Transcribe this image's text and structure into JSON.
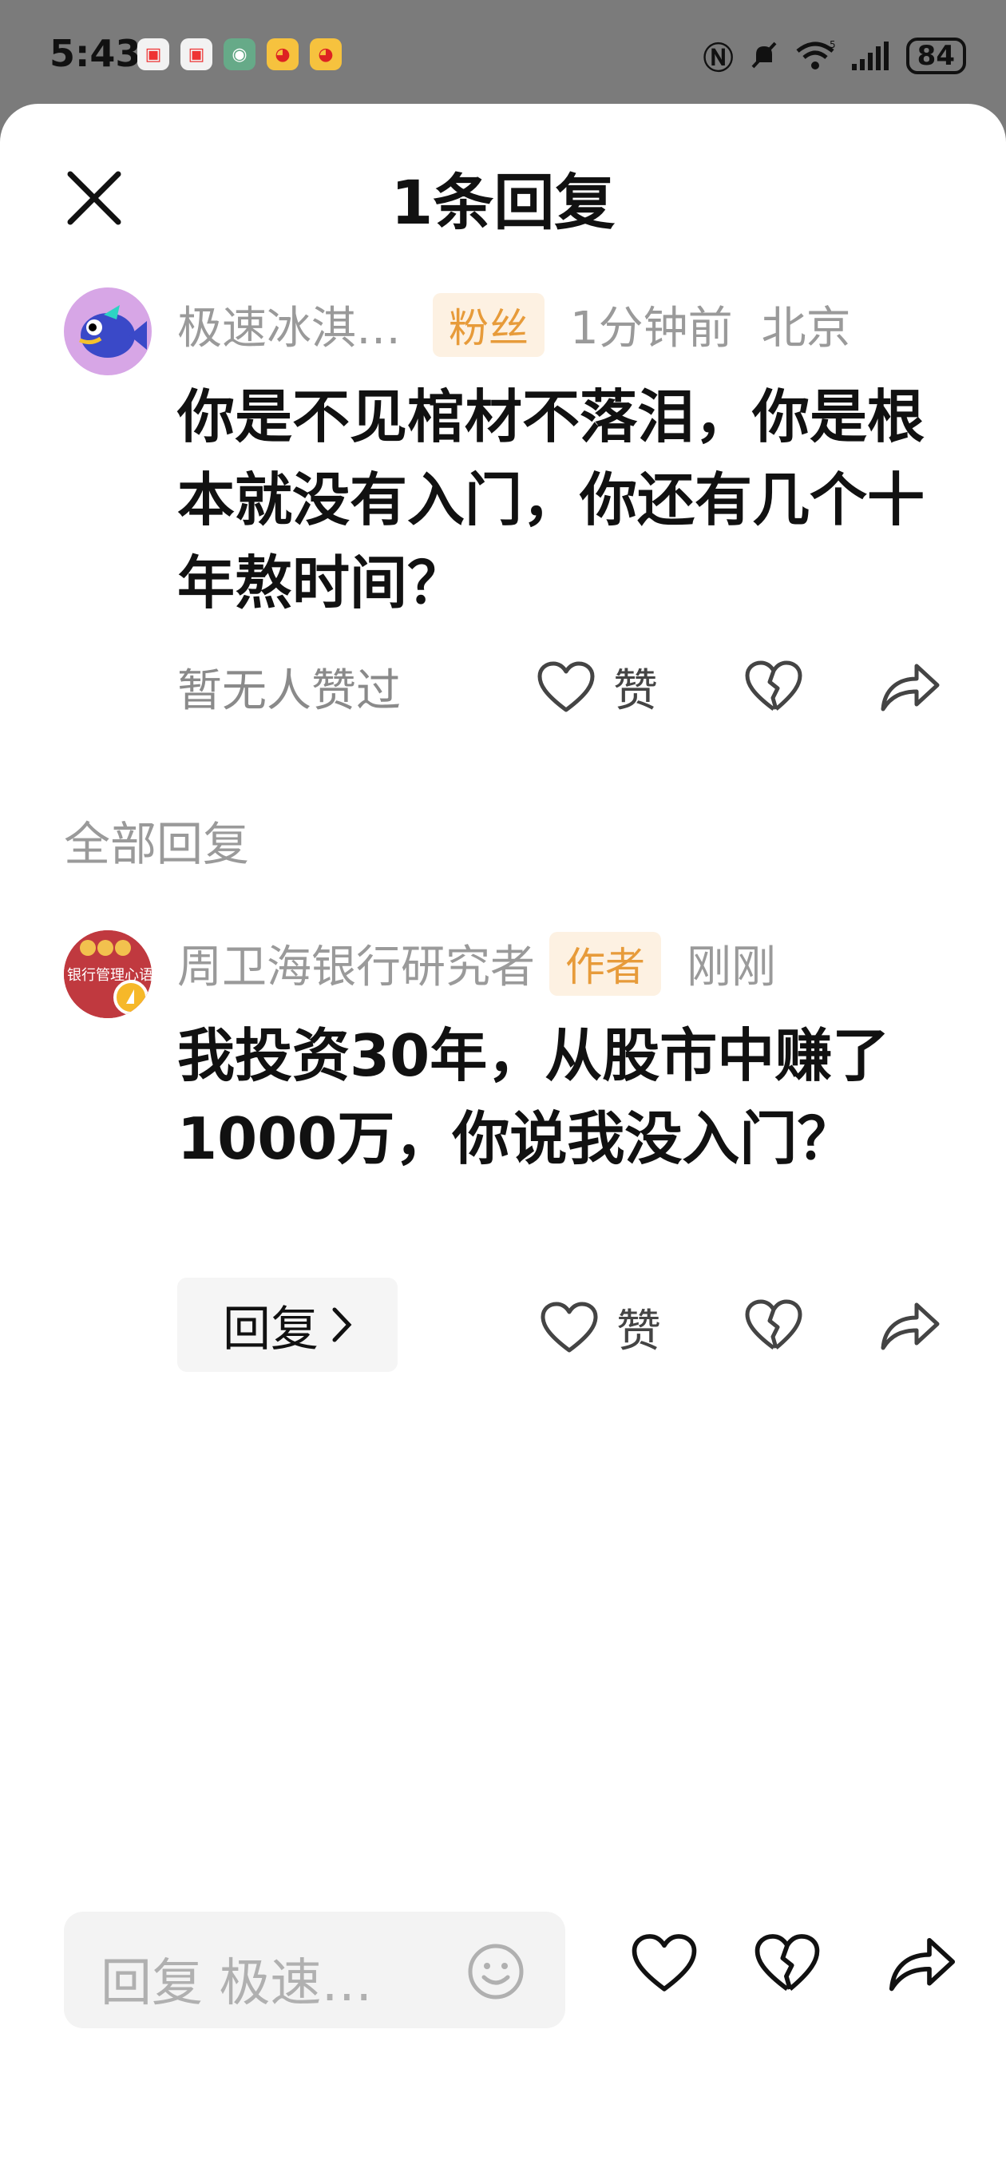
{
  "status_bar": {
    "time": "5:43",
    "battery": "84",
    "network": "5G"
  },
  "header": {
    "title": "1条回复"
  },
  "main_comment": {
    "username": "极速冰淇…",
    "badge": "粉丝",
    "time": "1分钟前",
    "location": "北京",
    "text": "你是不见棺材不落泪，你是根本就没有入门，你还有几个十年熬时间？",
    "likes_text": "暂无人赞过",
    "like_label": "赞"
  },
  "section": {
    "label": "全部回复"
  },
  "reply": {
    "username": "周卫海银行研究者",
    "badge": "作者",
    "time": "刚刚",
    "text": "我投资30年，从股市中赚了1000万，你说我没入门？",
    "reply_button": "回复",
    "like_label": "赞",
    "avatar_text": "银行管理心语"
  },
  "bottom_bar": {
    "placeholder": "回复 极速…"
  },
  "colors": {
    "badge_bg": "#fdf1e2",
    "badge_text": "#e79b3a",
    "muted": "#9a9a9a",
    "status_bar_bg": "#7b7b7b"
  },
  "icons": [
    "close-icon",
    "heart-icon",
    "broken-heart-icon",
    "share-icon",
    "chevron-right-icon",
    "emoji-icon",
    "mute-icon",
    "wifi-icon",
    "signal-icon",
    "nfc-icon"
  ]
}
